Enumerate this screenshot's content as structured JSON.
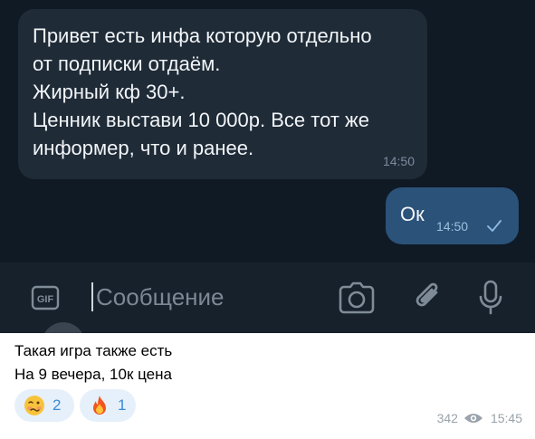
{
  "screenshot": {
    "incoming_message": {
      "lines": [
        "Привет есть инфа которую отдельно",
        "от подписки отдаём.",
        "Жирный кф 30+.",
        "Ценник выстави 10 000р. Все тот же",
        "информер, что и ранее."
      ],
      "time": "14:50"
    },
    "outgoing_message": {
      "text": "Ок",
      "time": "14:50"
    },
    "composer": {
      "placeholder": "Сообщение",
      "icons": [
        "gif-icon",
        "camera-icon",
        "paperclip-icon",
        "microphone-icon"
      ]
    }
  },
  "post": {
    "caption_lines": [
      "Такая игра также есть",
      "На 9 вечера, 10к цена"
    ],
    "reactions": [
      {
        "emoji": "woozy-face",
        "count": "2"
      },
      {
        "emoji": "fire",
        "count": "1"
      }
    ],
    "views": "342",
    "time": "15:45"
  },
  "colors": {
    "dark_bg": "#0e1621",
    "incoming_bubble": "#1f2b37",
    "outgoing_bubble": "#2b5278",
    "composer_bg": "#17212b",
    "reaction_bg": "#e6f0fa",
    "reaction_count": "#3a8ad6"
  }
}
